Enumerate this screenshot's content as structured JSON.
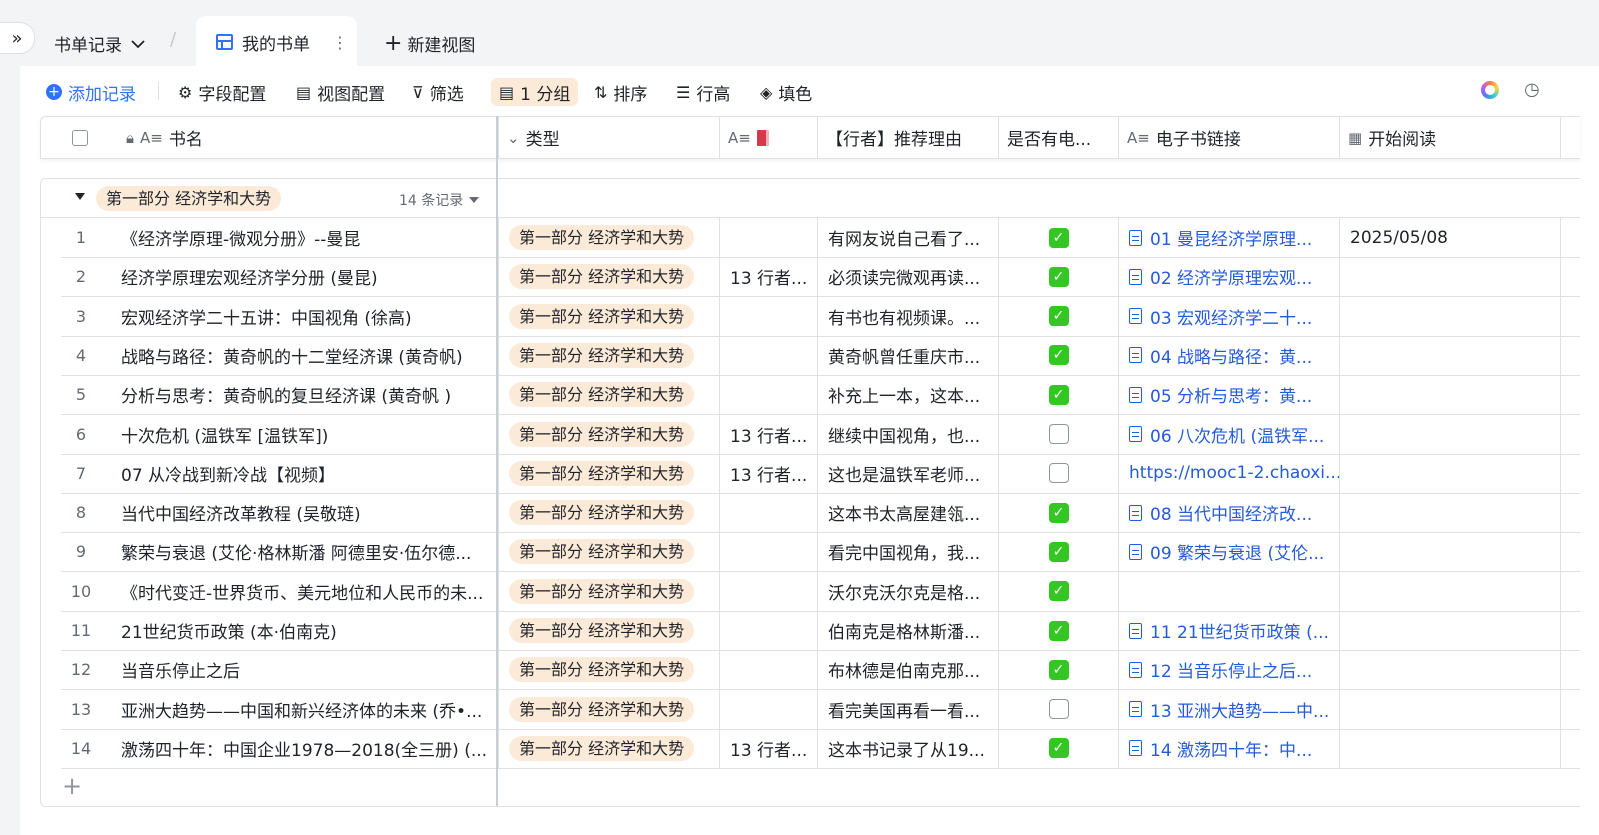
{
  "topbar": {
    "expander_icon": "»",
    "crumb_label": "书单记录",
    "slash": "/",
    "tab_label": "我的书单",
    "tab_more": "⋮",
    "new_view_label": "新建视图"
  },
  "toolbar": {
    "add_record": "添加记录",
    "field_config": "字段配置",
    "view_config": "视图配置",
    "filter": "筛选",
    "group": "1 分组",
    "sort": "排序",
    "row_height": "行高",
    "fill_color": "填色"
  },
  "columns": {
    "name": "书名",
    "type": "类型",
    "recommend": "【行者】推荐理由",
    "has_ebook": "是否有电...",
    "ebook_link": "电子书链接",
    "start_read": "开始阅读"
  },
  "group": {
    "label": "第一部分 经济学和大势",
    "count": "14 条记录"
  },
  "rows": [
    {
      "n": "1",
      "name": "《经济学原理-微观分册》--曼昆",
      "type": "第一部分 经济学和大势",
      "col3": "",
      "reason": "有网友说自己看了...",
      "checked": true,
      "link": "01 曼昆经济学原理...",
      "link_doc": true,
      "date": "2025/05/08"
    },
    {
      "n": "2",
      "name": "经济学原理宏观经济学分册 (曼昆)",
      "type": "第一部分 经济学和大势",
      "col3": "13 行者...",
      "reason": "必须读完微观再读...",
      "checked": true,
      "link": "02 经济学原理宏观...",
      "link_doc": true,
      "date": ""
    },
    {
      "n": "3",
      "name": "宏观经济学二十五讲：中国视角 (徐高)",
      "type": "第一部分 经济学和大势",
      "col3": "",
      "reason": "有书也有视频课。...",
      "checked": true,
      "link": "03 宏观经济学二十...",
      "link_doc": true,
      "date": ""
    },
    {
      "n": "4",
      "name": "战略与路径：黄奇帆的十二堂经济课 (黄奇帆)",
      "type": "第一部分 经济学和大势",
      "col3": "",
      "reason": "黄奇帆曾任重庆市...",
      "checked": true,
      "link": "04 战略与路径：黄...",
      "link_doc": true,
      "date": ""
    },
    {
      "n": "5",
      "name": "分析与思考：黄奇帆的复旦经济课 (黄奇帆 )",
      "type": "第一部分 经济学和大势",
      "col3": "",
      "reason": "补充上一本，这本...",
      "checked": true,
      "link": "05 分析与思考：黄...",
      "link_doc": true,
      "date": ""
    },
    {
      "n": "6",
      "name": "十次危机 (温铁军 [温铁军])",
      "type": "第一部分 经济学和大势",
      "col3": "13 行者...",
      "reason": "继续中国视角，也...",
      "checked": false,
      "link": "06 八次危机 (温铁军...",
      "link_doc": true,
      "date": ""
    },
    {
      "n": "7",
      "name": "07 从冷战到新冷战【视频】",
      "type": "第一部分 经济学和大势",
      "col3": "13 行者...",
      "reason": "这也是温铁军老师...",
      "checked": false,
      "link": "https://mooc1-2.chaoxi...",
      "link_doc": false,
      "date": ""
    },
    {
      "n": "8",
      "name": "当代中国经济改革教程 (吴敬琏)",
      "type": "第一部分 经济学和大势",
      "col3": "",
      "reason": "这本书太高屋建瓴...",
      "checked": true,
      "link": "08 当代中国经济改...",
      "link_doc": true,
      "date": ""
    },
    {
      "n": "9",
      "name": "繁荣与衰退 (艾伦·格林斯潘 阿德里安·伍尔德...",
      "type": "第一部分 经济学和大势",
      "col3": "",
      "reason": "看完中国视角，我...",
      "checked": true,
      "link": "09 繁荣与衰退 (艾伦...",
      "link_doc": true,
      "date": ""
    },
    {
      "n": "10",
      "name": "《时代变迁-世界货币、美元地位和人民币的未...",
      "type": "第一部分 经济学和大势",
      "col3": "",
      "reason": "沃尔克沃尔克是格...",
      "checked": true,
      "link": "",
      "link_doc": false,
      "date": ""
    },
    {
      "n": "11",
      "name": "21世纪货币政策 (本·伯南克)",
      "type": "第一部分 经济学和大势",
      "col3": "",
      "reason": "伯南克是格林斯潘...",
      "checked": true,
      "link": "11 21世纪货币政策 (...",
      "link_doc": true,
      "date": ""
    },
    {
      "n": "12",
      "name": "当音乐停止之后",
      "type": "第一部分 经济学和大势",
      "col3": "",
      "reason": "布林德是伯南克那...",
      "checked": true,
      "link": "12 当音乐停止之后...",
      "link_doc": true,
      "date": ""
    },
    {
      "n": "13",
      "name": "亚洲大趋势——中国和新兴经济体的未来 (乔•...",
      "type": "第一部分 经济学和大势",
      "col3": "",
      "reason": "看完美国再看一看...",
      "checked": false,
      "link": "13 亚洲大趋势——中...",
      "link_doc": true,
      "date": ""
    },
    {
      "n": "14",
      "name": "激荡四十年：中国企业1978—2018(全三册) (...",
      "type": "第一部分 经济学和大势",
      "col3": "13 行者...",
      "reason": "这本书记录了从19...",
      "checked": true,
      "link": "14 激荡四十年：中...",
      "link_doc": true,
      "date": ""
    }
  ],
  "add_row_icon": "+"
}
